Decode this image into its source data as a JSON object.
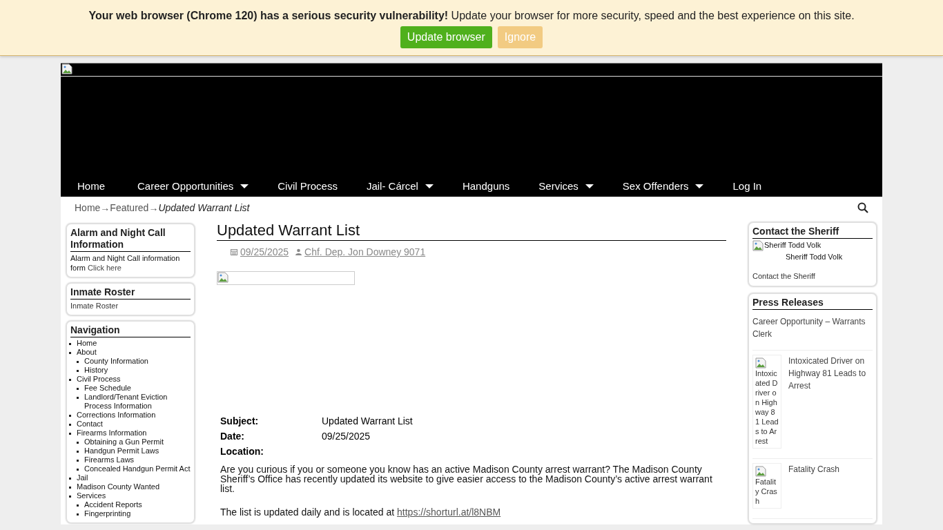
{
  "update_banner": {
    "message_bold": "Your web browser (Chrome 120) has a serious security vulnerability!",
    "message": "Update your browser for more security, speed and the best experience on this site.",
    "buttons": [
      {
        "label": "Update browser",
        "kind": "primary"
      },
      {
        "label": "Ignore",
        "kind": "secondary"
      }
    ]
  },
  "main_menu": [
    {
      "label": "Home",
      "has_submenu": false
    },
    {
      "label": "Career Opportunities",
      "has_submenu": true
    },
    {
      "label": "Civil Process",
      "has_submenu": false
    },
    {
      "label": "Jail- Cárcel",
      "has_submenu": true
    },
    {
      "label": "Handguns",
      "has_submenu": false
    },
    {
      "label": "Services",
      "has_submenu": true
    },
    {
      "label": "Sex Offenders",
      "has_submenu": true
    },
    {
      "label": "Log In",
      "has_submenu": false
    }
  ],
  "breadcrumb": [
    {
      "label": "Home",
      "kind": "link"
    },
    {
      "label": "→",
      "kind": "separator"
    },
    {
      "label": "Featured",
      "kind": "link"
    },
    {
      "label": "→",
      "kind": "separator"
    },
    {
      "label": "Updated Warrant List",
      "kind": "current"
    }
  ],
  "left_sidebar": [
    {
      "kind": "text",
      "title": "Alarm and Night Call Information",
      "text": "Alarm and Night Call information form",
      "link": "Click here"
    },
    {
      "kind": "text",
      "title": "Inmate Roster",
      "link": "Inmate Roster"
    },
    {
      "kind": "nav",
      "title": "Navigation",
      "items": [
        {
          "label": "Home"
        },
        {
          "label": "About",
          "children": [
            {
              "label": "County Information"
            },
            {
              "label": "History"
            }
          ]
        },
        {
          "label": "Civil Process",
          "children": [
            {
              "label": "Fee Schedule"
            },
            {
              "label": "Landlord/Tenant Eviction Process Information"
            }
          ]
        },
        {
          "label": "Corrections Information"
        },
        {
          "label": "Contact"
        },
        {
          "label": "Firearms Information",
          "children": [
            {
              "label": "Obtaining a Gun Permit"
            },
            {
              "label": "Handgun Permit Laws"
            },
            {
              "label": "Firearms Laws"
            },
            {
              "label": "Concealed Handgun Permit Act"
            }
          ]
        },
        {
          "label": "Jail"
        },
        {
          "label": "Madison County Wanted"
        },
        {
          "label": "Services",
          "children": [
            {
              "label": "Accident Reports"
            },
            {
              "label": "Fingerprinting"
            }
          ]
        }
      ]
    }
  ],
  "article": {
    "title": "Updated Warrant List",
    "date": "09/25/2025",
    "author": "Chf. Dep. Jon Downey 9071",
    "details": [
      {
        "label": "Subject:",
        "value": "Updated Warrant List"
      },
      {
        "label": "Date:",
        "value": "09/25/2025"
      },
      {
        "label": "Location:"
      }
    ],
    "paragraphs": [
      {
        "text": "Are you curious if you or someone you know has an active Madison County arrest warrant? The Madison County Sheriff’s Office has recently updated its website to give easier access to the Madison County’s active arrest warrant list."
      },
      {
        "text": "The list is updated daily and is located at",
        "link": "https://shorturl.at/l8NBM"
      }
    ]
  },
  "right_sidebar": {
    "contact": {
      "title": "Contact the Sheriff",
      "image_alt": "Sheriff Todd Volk",
      "caption": "Sheriff Todd Volk",
      "link": "Contact the Sheriff"
    },
    "press": {
      "title": "Press Releases",
      "items": [
        {
          "title": "Career Opportunity – Warrants Clerk"
        },
        {
          "title": "Intoxicated Driver on Highway 81 Leads to Arrest",
          "image_alt": "Intoxicated Driver on Highway 81 Leads to Arrest"
        },
        {
          "title": "Fatality Crash",
          "image_alt": "Fatality Crash"
        }
      ]
    }
  }
}
